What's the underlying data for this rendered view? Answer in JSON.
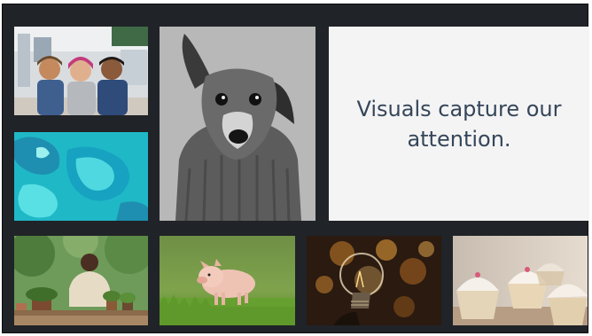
{
  "gallery": {
    "quote": "Visuals capture our attention.",
    "tiles": [
      {
        "subject": "three-children-classroom"
      },
      {
        "subject": "aerial-reef-lagoon"
      },
      {
        "subject": "dog-in-sweater"
      },
      {
        "subject": "man-with-potted-plants"
      },
      {
        "subject": "piglet-in-grass"
      },
      {
        "subject": "lightbulb-bokeh"
      },
      {
        "subject": "cupcakes"
      }
    ]
  },
  "colors": {
    "frame": "#202327",
    "quote_background": "#f4f4f4",
    "quote_text": "#35465a"
  }
}
